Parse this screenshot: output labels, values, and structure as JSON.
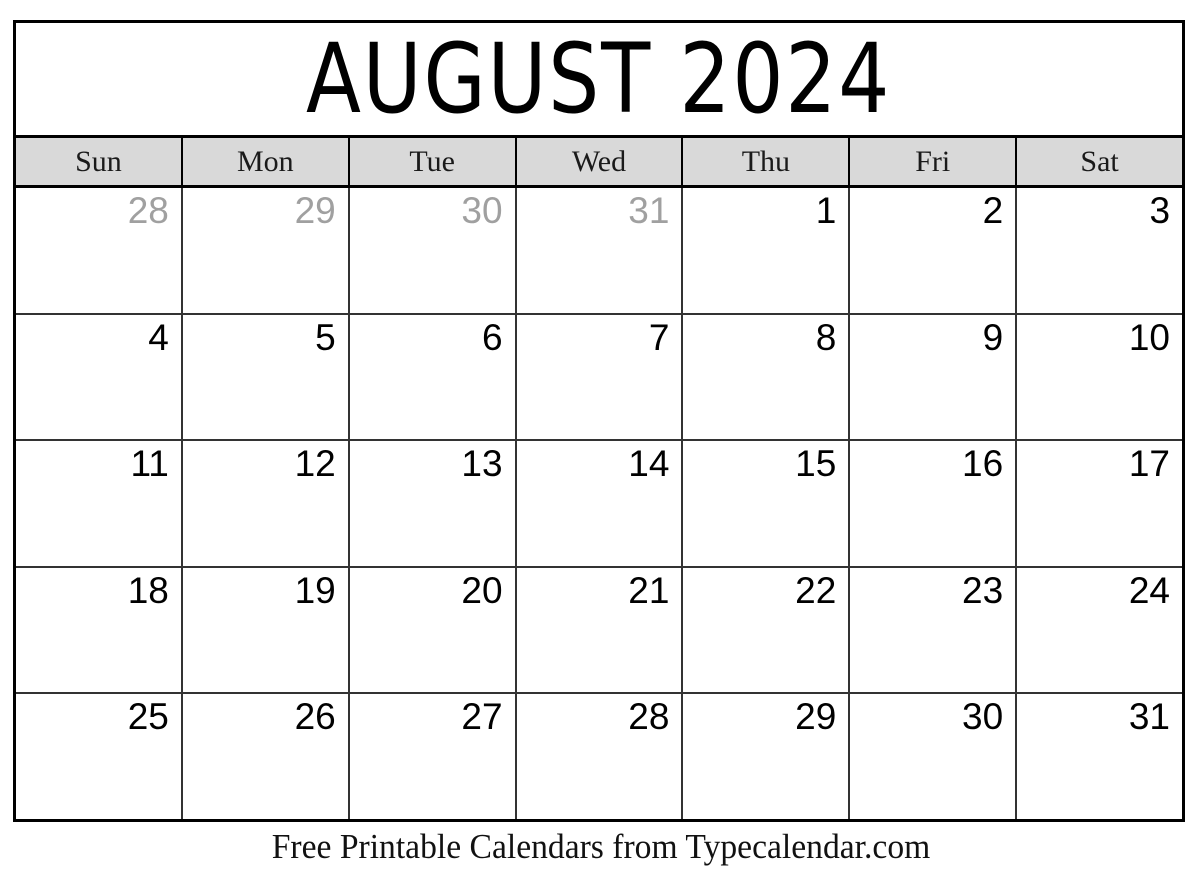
{
  "calendar": {
    "title": "AUGUST 2024",
    "month": "AUGUST",
    "year": "2024",
    "weekday_headers": [
      "Sun",
      "Mon",
      "Tue",
      "Wed",
      "Thu",
      "Fri",
      "Sat"
    ],
    "weeks": [
      [
        {
          "number": "28",
          "muted": true
        },
        {
          "number": "29",
          "muted": true
        },
        {
          "number": "30",
          "muted": true
        },
        {
          "number": "31",
          "muted": true
        },
        {
          "number": "1",
          "muted": false
        },
        {
          "number": "2",
          "muted": false
        },
        {
          "number": "3",
          "muted": false
        }
      ],
      [
        {
          "number": "4",
          "muted": false
        },
        {
          "number": "5",
          "muted": false
        },
        {
          "number": "6",
          "muted": false
        },
        {
          "number": "7",
          "muted": false
        },
        {
          "number": "8",
          "muted": false
        },
        {
          "number": "9",
          "muted": false
        },
        {
          "number": "10",
          "muted": false
        }
      ],
      [
        {
          "number": "11",
          "muted": false
        },
        {
          "number": "12",
          "muted": false
        },
        {
          "number": "13",
          "muted": false
        },
        {
          "number": "14",
          "muted": false
        },
        {
          "number": "15",
          "muted": false
        },
        {
          "number": "16",
          "muted": false
        },
        {
          "number": "17",
          "muted": false
        }
      ],
      [
        {
          "number": "18",
          "muted": false
        },
        {
          "number": "19",
          "muted": false
        },
        {
          "number": "20",
          "muted": false
        },
        {
          "number": "21",
          "muted": false
        },
        {
          "number": "22",
          "muted": false
        },
        {
          "number": "23",
          "muted": false
        },
        {
          "number": "24",
          "muted": false
        }
      ],
      [
        {
          "number": "25",
          "muted": false
        },
        {
          "number": "26",
          "muted": false
        },
        {
          "number": "27",
          "muted": false
        },
        {
          "number": "28",
          "muted": false
        },
        {
          "number": "29",
          "muted": false
        },
        {
          "number": "30",
          "muted": false
        },
        {
          "number": "31",
          "muted": false
        }
      ]
    ]
  },
  "footer": {
    "text": "Free Printable Calendars from Typecalendar.com"
  },
  "colors": {
    "header_background": "#d9d9d9",
    "grid_line": "#333333",
    "frame": "#000000",
    "muted_day_text": "#a0a0a0",
    "day_text": "#000000",
    "page_background": "#ffffff"
  }
}
